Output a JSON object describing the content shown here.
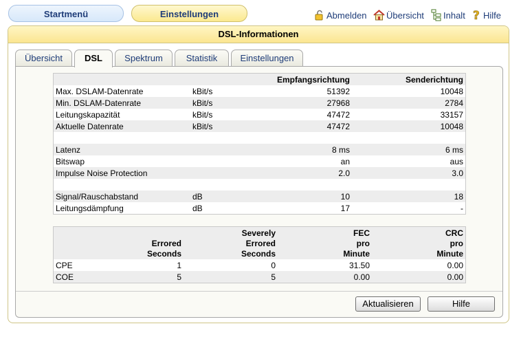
{
  "nav": {
    "start_label": "Startmenü",
    "settings_label": "Einstellungen"
  },
  "toplinks": {
    "logout": "Abmelden",
    "overview": "Übersicht",
    "content": "Inhalt",
    "help": "Hilfe"
  },
  "panel": {
    "title": "DSL-Informationen"
  },
  "tabs": [
    "Übersicht",
    "DSL",
    "Spektrum",
    "Statistik",
    "Einstellungen"
  ],
  "active_tab": "DSL",
  "main_table": {
    "headers": [
      "",
      "",
      "Empfangsrichtung",
      "Senderichtung"
    ],
    "rows": [
      [
        "Max. DSLAM-Datenrate",
        "kBit/s",
        "51392",
        "10048"
      ],
      [
        "Min. DSLAM-Datenrate",
        "kBit/s",
        "27968",
        "2784"
      ],
      [
        "Leitungskapazität",
        "kBit/s",
        "47472",
        "33157"
      ],
      [
        "Aktuelle Datenrate",
        "kBit/s",
        "47472",
        "10048"
      ],
      [
        "",
        "",
        "",
        ""
      ],
      [
        "Latenz",
        "",
        "8 ms",
        "6 ms"
      ],
      [
        "Bitswap",
        "",
        "an",
        "aus"
      ],
      [
        "Impulse Noise Protection",
        "",
        "2.0",
        "3.0"
      ],
      [
        "",
        "",
        "",
        ""
      ],
      [
        "Signal/Rauschabstand",
        "dB",
        "10",
        "18"
      ],
      [
        "Leitungsdämpfung",
        "dB",
        "17",
        "-"
      ]
    ]
  },
  "error_table": {
    "headers": [
      [
        "",
        ""
      ],
      [
        "Errored",
        "Seconds"
      ],
      [
        "Severely",
        "Errored",
        "Seconds"
      ],
      [
        "FEC",
        "pro",
        "Minute"
      ],
      [
        "CRC",
        "pro",
        "Minute"
      ]
    ],
    "rows": [
      [
        "CPE",
        "1",
        "0",
        "31.50",
        "0.00"
      ],
      [
        "COE",
        "5",
        "5",
        "0.00",
        "0.00"
      ]
    ]
  },
  "buttons": {
    "refresh": "Aktualisieren",
    "help": "Hilfe"
  },
  "colors": {
    "link": "#1e3c78",
    "header_yellow": "#fbe591",
    "nav_blue": "#d7e8fa",
    "row_alt": "#ededed"
  }
}
